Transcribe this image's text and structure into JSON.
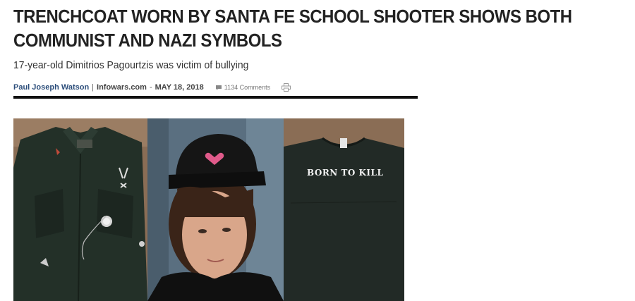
{
  "article": {
    "headline": "TRENCHCOAT WORN BY SANTA FE SCHOOL SHOOTER SHOWS BOTH COMMUNIST AND NAZI SYMBOLS",
    "subtitle": "17-year-old Dimitrios Pagourtzis was victim of bullying",
    "author": "Paul Joseph Watson",
    "separator": "|",
    "source": "Infowars.com",
    "date_prefix": "-",
    "date": "MAY 18, 2018",
    "comments": "1134 Comments"
  },
  "images": {
    "shirt_print": "BORN TO KILL"
  },
  "icons": {
    "comments": "speech-bubble-icon",
    "print": "printer-icon"
  },
  "colors": {
    "author_link": "#2b4d7a",
    "rule": "#111111",
    "headline": "#222222"
  }
}
